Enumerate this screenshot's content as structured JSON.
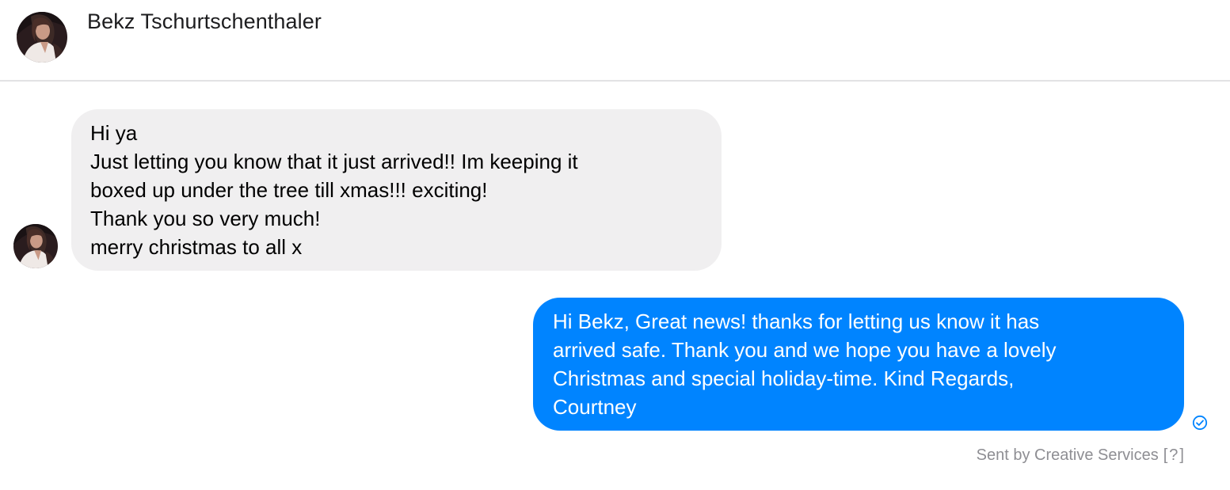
{
  "conversation": {
    "contact_name": "Bekz Tschurtschenthaler"
  },
  "messages": [
    {
      "direction": "incoming",
      "text": "Hi ya\nJust letting you know that it just arrived!! Im keeping it\nboxed up under the tree till xmas!!! exciting!\nThank you so very much!\nmerry christmas to all x"
    },
    {
      "direction": "outgoing",
      "text": "Hi Bekz, Great news! thanks for letting us know it has\narrived safe. Thank you and we hope you have a lovely\nChristmas and special holiday-time. Kind Regards,\nCourtney",
      "status_icon": "check-circle-icon"
    }
  ],
  "footer": {
    "sent_by": "Sent by Creative Services",
    "help": "[?]"
  },
  "colors": {
    "outgoing_bubble": "#0084ff",
    "incoming_bubble": "#f0eff0",
    "divider": "#e2e2e4",
    "meta_text": "#8e8e93"
  }
}
